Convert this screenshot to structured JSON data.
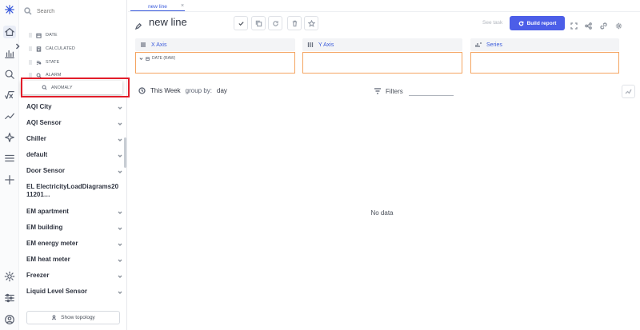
{
  "sidebar": {
    "search_placeholder": "Search",
    "fields": [
      {
        "label": "DATE",
        "icon": "calendar-icon"
      },
      {
        "label": "CALCULATED",
        "icon": "calculator-icon"
      },
      {
        "label": "STATE",
        "icon": "state-icon"
      },
      {
        "label": "ALARM",
        "icon": "alarm-icon"
      }
    ],
    "dragging": {
      "label": "ANOMALY",
      "icon": "anomaly-search-icon"
    },
    "groups": [
      "AQI City",
      "AQI Sensor",
      "Chiller",
      "default",
      "Door Sensor",
      "EL ElectricityLoadDiagrams2011201…",
      "EM apartment",
      "EM building",
      "EM energy meter",
      "EM heat meter",
      "Freezer",
      "Liquid Level Sensor"
    ],
    "topology_button": "Show topology"
  },
  "tabs": [
    {
      "label": "new line",
      "close": "×"
    }
  ],
  "report": {
    "title": "new line",
    "see_task": "See task",
    "build_button": "Build report"
  },
  "panels": {
    "x_axis": {
      "title": "X Axis",
      "chip": "DATE (RAW)"
    },
    "y_axis": {
      "title": "Y Axis"
    },
    "series": {
      "title": "Series"
    }
  },
  "period": {
    "label": "This Week",
    "group_by_label": "group by:",
    "group_by_value": "day"
  },
  "filters": {
    "label": "Filters",
    "value": ""
  },
  "empty_state": "No data",
  "colors": {
    "accent": "#4c5ee8",
    "drop_zone": "#f4a460",
    "highlight": "#e21d2a"
  }
}
